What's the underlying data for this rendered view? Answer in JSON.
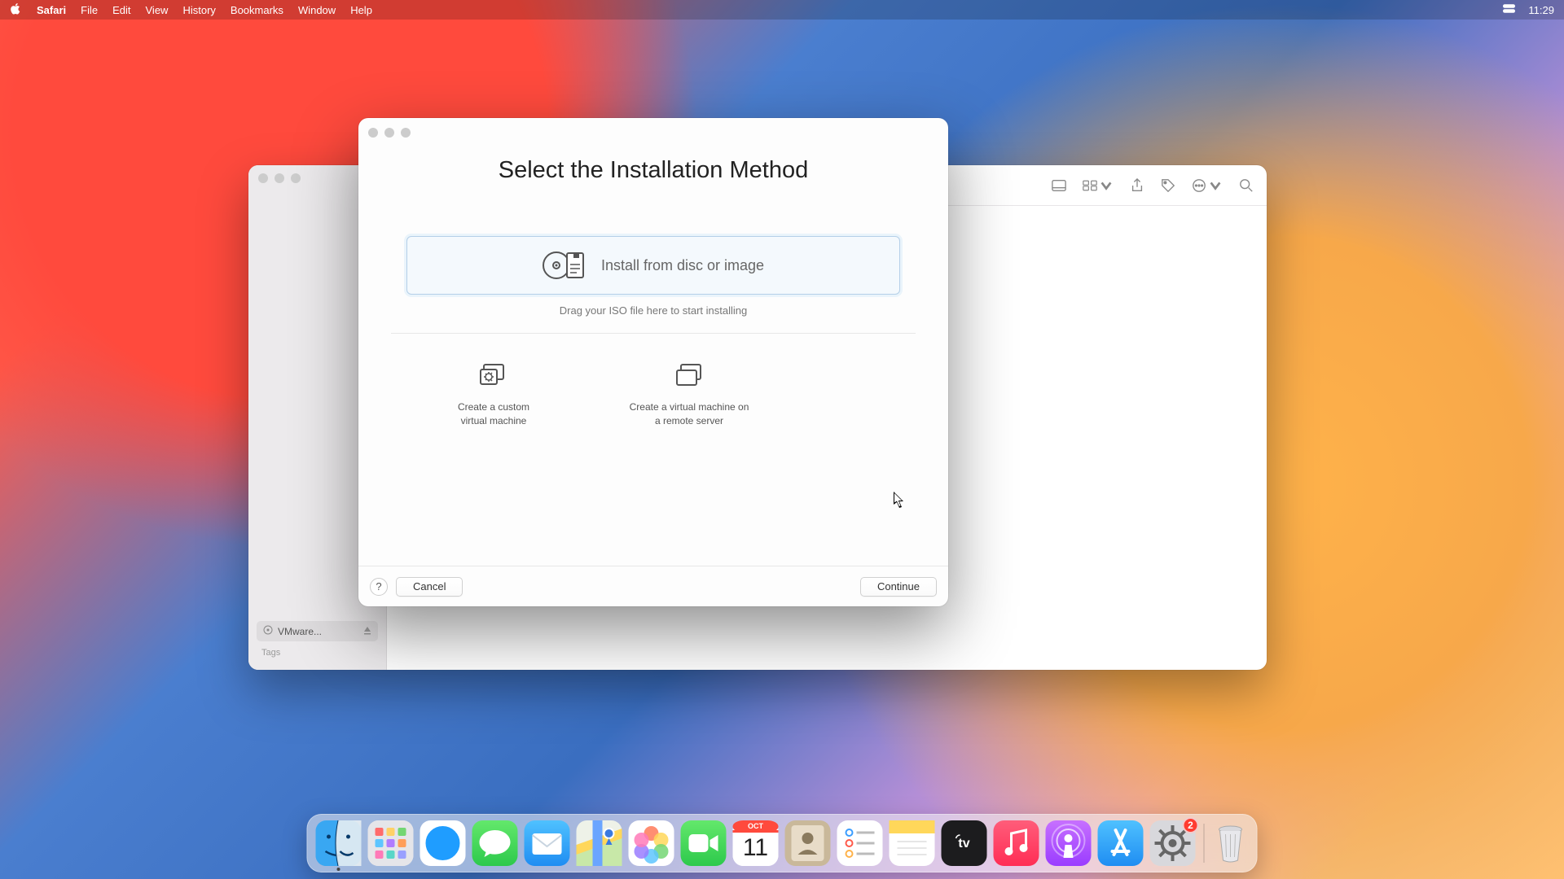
{
  "menubar": {
    "app": "Safari",
    "items": [
      "File",
      "Edit",
      "View",
      "History",
      "Bookmarks",
      "Window",
      "Help"
    ],
    "time": "11:29"
  },
  "finder": {
    "sidebar_item": "VMware...",
    "tags_label": "Tags"
  },
  "modal": {
    "title": "Select the Installation Method",
    "primary_label": "Install from disc or image",
    "primary_hint": "Drag your ISO file here to start installing",
    "option_custom_l1": "Create a custom",
    "option_custom_l2": "virtual machine",
    "option_remote_l1": "Create a virtual machine on",
    "option_remote_l2": "a remote server",
    "help": "?",
    "cancel": "Cancel",
    "continue": "Continue"
  },
  "dock": {
    "items": [
      {
        "name": "finder",
        "label": "Finder"
      },
      {
        "name": "launchpad",
        "label": "Launchpad"
      },
      {
        "name": "safari",
        "label": "Safari"
      },
      {
        "name": "messages",
        "label": "Messages"
      },
      {
        "name": "mail",
        "label": "Mail"
      },
      {
        "name": "maps",
        "label": "Maps"
      },
      {
        "name": "photos",
        "label": "Photos"
      },
      {
        "name": "facetime",
        "label": "FaceTime"
      },
      {
        "name": "calendar",
        "label": "Calendar"
      },
      {
        "name": "contacts",
        "label": "Contacts"
      },
      {
        "name": "reminders",
        "label": "Reminders"
      },
      {
        "name": "notes",
        "label": "Notes"
      },
      {
        "name": "tv",
        "label": "TV"
      },
      {
        "name": "music",
        "label": "Music"
      },
      {
        "name": "podcasts",
        "label": "Podcasts"
      },
      {
        "name": "appstore",
        "label": "App Store"
      },
      {
        "name": "settings",
        "label": "System Preferences"
      }
    ],
    "calendar_month": "OCT",
    "calendar_day": "11",
    "settings_badge": "2",
    "trash": "Trash"
  }
}
